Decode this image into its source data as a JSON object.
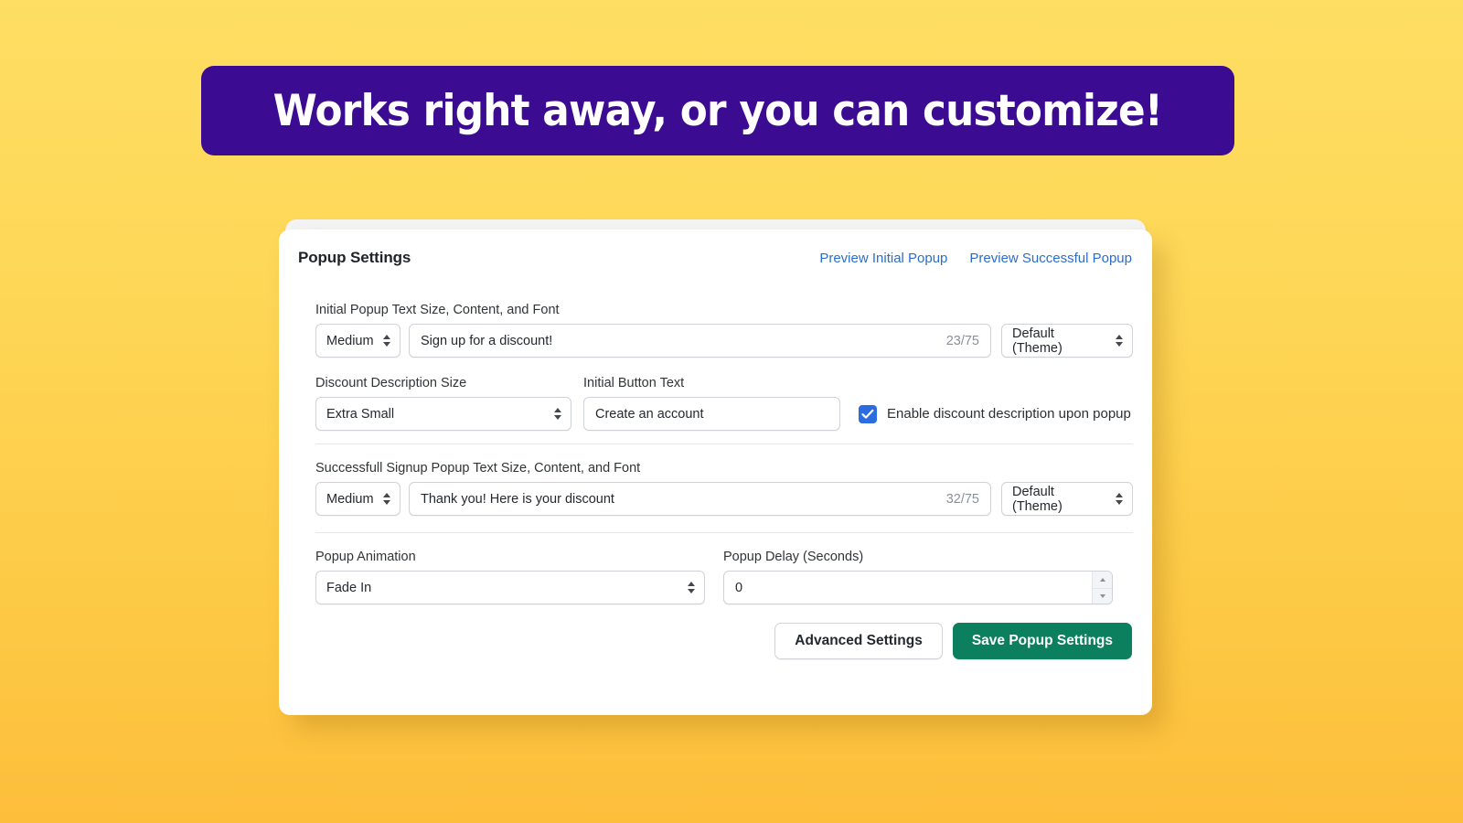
{
  "banner": {
    "text": "Works right away, or you can customize!",
    "background": "#3B0B92",
    "text_color": "#FFFFFF"
  },
  "page": {
    "background_top": "#FEDE63",
    "background_bottom": "#FDBE3C"
  },
  "card": {
    "title": "Popup Settings",
    "header_links": [
      {
        "label": "Preview Initial Popup"
      },
      {
        "label": "Preview Successful Popup"
      }
    ],
    "link_color": "#2C6ECB",
    "sections": {
      "initial_popup": {
        "label": "Initial Popup Text Size, Content, and Font",
        "size_select": "Medium",
        "content_value": "Sign up for a discount!",
        "content_counter": "23/75",
        "font_select": "Default (Theme)"
      },
      "discount_description": {
        "size_label": "Discount Description Size",
        "size_select": "Extra Small",
        "button_text_label": "Initial Button Text",
        "button_text_value": "Create an account",
        "checkbox_label": "Enable discount description upon popup",
        "checkbox_checked": true,
        "checkbox_color": "#2B6CE0"
      },
      "successful_popup": {
        "label": "Successfull Signup Popup Text Size, Content, and Font",
        "size_select": "Medium",
        "content_value": "Thank you! Here is your discount",
        "content_counter": "32/75",
        "font_select": "Default (Theme)"
      },
      "animation": {
        "animation_label": "Popup Animation",
        "animation_select": "Fade In",
        "delay_label": "Popup Delay (Seconds)",
        "delay_value": "0"
      }
    },
    "footer": {
      "advanced_label": "Advanced Settings",
      "save_label": "Save Popup Settings",
      "save_color": "#0B7F5E"
    }
  }
}
